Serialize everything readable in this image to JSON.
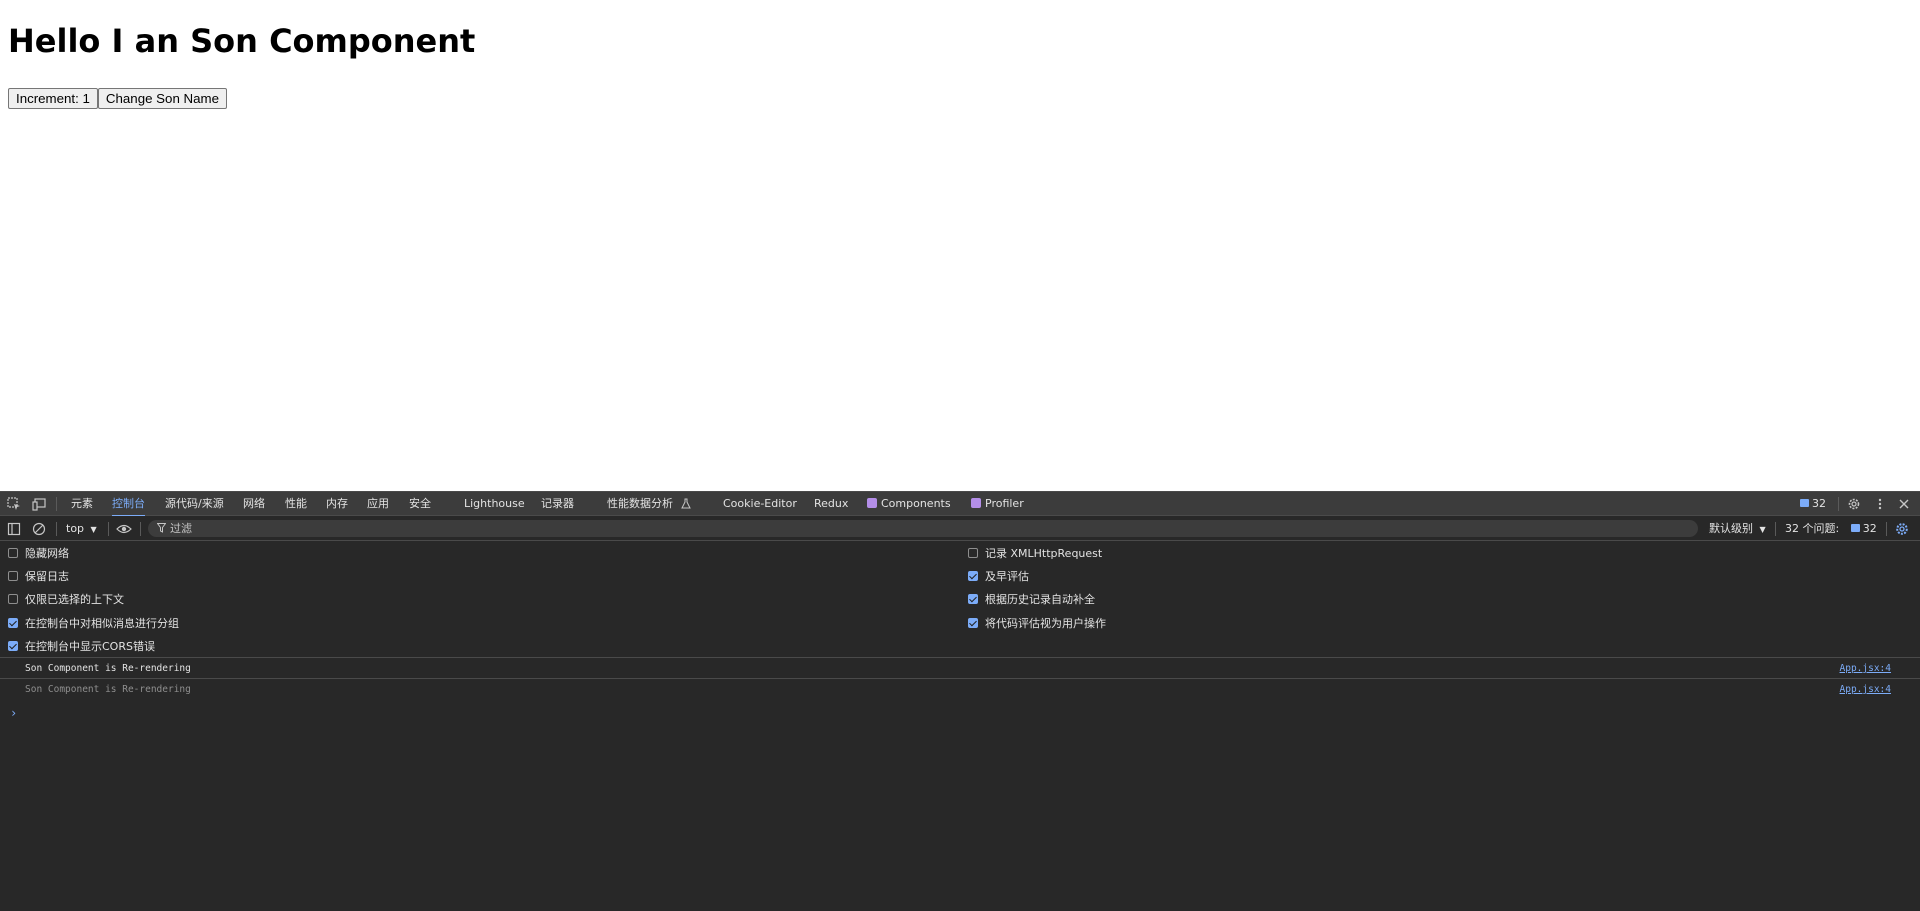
{
  "page": {
    "heading": "Hello I an Son Component",
    "increment_button": "Increment: 1",
    "change_name_button": "Change Son Name"
  },
  "devtools": {
    "tabs": [
      {
        "label": "元素",
        "active": false
      },
      {
        "label": "控制台",
        "active": true
      },
      {
        "label": "源代码/来源",
        "active": false
      },
      {
        "label": "网络",
        "active": false
      },
      {
        "label": "性能",
        "active": false
      },
      {
        "label": "内存",
        "active": false
      },
      {
        "label": "应用",
        "active": false
      },
      {
        "label": "安全",
        "active": false
      },
      {
        "label": "Lighthouse",
        "active": false
      },
      {
        "label": "记录器",
        "active": false
      },
      {
        "label": "性能数据分析",
        "active": false
      },
      {
        "label": "Cookie-Editor",
        "active": false
      },
      {
        "label": "Redux",
        "active": false
      },
      {
        "label": "Components",
        "active": false
      },
      {
        "label": "Profiler",
        "active": false
      }
    ],
    "issues_count": "32",
    "console_toolbar": {
      "context": "top",
      "filter_placeholder": "过滤",
      "level": "默认级别",
      "issues_label": "32 个问题:",
      "issues_count": "32"
    },
    "settings": {
      "left": [
        {
          "label": "隐藏网络",
          "checked": false
        },
        {
          "label": "保留日志",
          "checked": false
        },
        {
          "label": "仅限已选择的上下文",
          "checked": false
        },
        {
          "label": "在控制台中对相似消息进行分组",
          "checked": true
        },
        {
          "label": "在控制台中显示CORS错误",
          "checked": true
        }
      ],
      "right": [
        {
          "label": "记录 XMLHttpRequest",
          "checked": false
        },
        {
          "label": "及早评估",
          "checked": true
        },
        {
          "label": "根据历史记录自动补全",
          "checked": true
        },
        {
          "label": "将代码评估视为用户操作",
          "checked": true
        }
      ]
    },
    "logs": [
      {
        "message": "Son Component is Re-rendering",
        "source": "App.jsx:4",
        "dimmed": false
      },
      {
        "message": "Son Component is Re-rendering",
        "source": "App.jsx:4",
        "dimmed": true
      }
    ],
    "prompt_symbol": "›",
    "colors": {
      "accent": "#7cacf8",
      "panel_bg": "#282828",
      "tabbar_bg": "#3c3c3c"
    }
  }
}
